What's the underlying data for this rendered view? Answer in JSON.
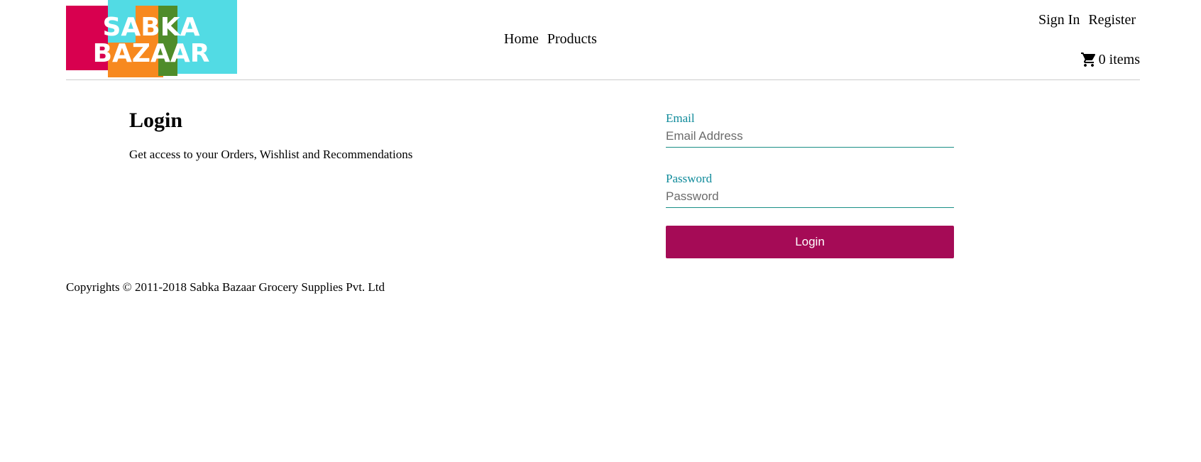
{
  "header": {
    "logo_text_line1": "SABKA",
    "logo_text_line2": "BAZAAR",
    "nav": {
      "home": "Home",
      "products": "Products"
    },
    "auth": {
      "sign_in": "Sign In",
      "register": "Register"
    },
    "cart": {
      "icon": "cart-icon",
      "count": "0",
      "label": "items"
    }
  },
  "main": {
    "title": "Login",
    "description": "Get access to your Orders, Wishlist and Recommendations",
    "form": {
      "email_label": "Email",
      "email_placeholder": "Email Address",
      "email_value": "",
      "password_label": "Password",
      "password_placeholder": "Password",
      "password_value": "",
      "submit_label": "Login"
    }
  },
  "footer": {
    "copyright": "Copyrights © 2011-2018 Sabka Bazaar Grocery Supplies Pvt. Ltd"
  },
  "colors": {
    "accent": "#a50b56",
    "label": "#0e8a9a",
    "underline": "#1a8f86",
    "logo_red": "#d8004f",
    "logo_orange": "#f7891f",
    "logo_green": "#4f8c2a",
    "logo_cyan": "#52dbe4"
  }
}
